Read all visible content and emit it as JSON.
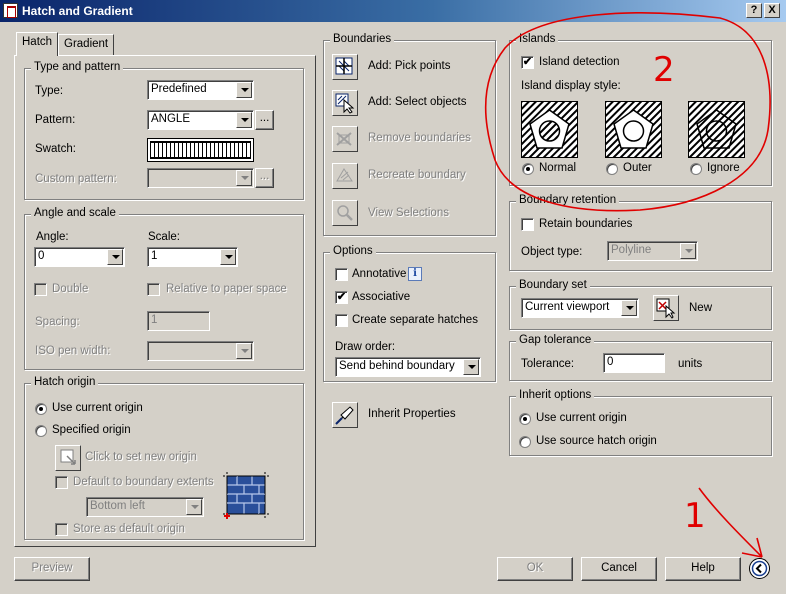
{
  "window": {
    "title": "Hatch and Gradient",
    "help_btn": "?",
    "close_btn": "X"
  },
  "tabs": [
    {
      "label": "Hatch"
    },
    {
      "label": "Gradient"
    }
  ],
  "type_pattern": {
    "legend": "Type and pattern",
    "type_label": "Type:",
    "type_value": "Predefined",
    "pattern_label": "Pattern:",
    "pattern_value": "ANGLE",
    "pattern_browse": "...",
    "swatch_label": "Swatch:",
    "custom_label": "Custom pattern:",
    "custom_value": "",
    "custom_browse": "..."
  },
  "angle_scale": {
    "legend": "Angle and scale",
    "angle_label": "Angle:",
    "angle_value": "0",
    "scale_label": "Scale:",
    "scale_value": "1",
    "double_label": "Double",
    "relative_label": "Relative to paper space",
    "spacing_label": "Spacing:",
    "spacing_value": "1",
    "iso_label": "ISO pen width:",
    "iso_value": ""
  },
  "hatch_origin": {
    "legend": "Hatch origin",
    "use_current": "Use current origin",
    "specified": "Specified origin",
    "click_to_set": "Click to set new origin",
    "default_extents": "Default to boundary extents",
    "extents_value": "Bottom left",
    "store_default": "Store as default origin"
  },
  "boundaries": {
    "legend": "Boundaries",
    "add_pick": "Add: Pick points",
    "add_select": "Add: Select objects",
    "remove": "Remove boundaries",
    "recreate": "Recreate boundary",
    "view": "View Selections"
  },
  "options": {
    "legend": "Options",
    "annotative": "Annotative",
    "associative": "Associative",
    "separate": "Create separate hatches",
    "draw_order_label": "Draw order:",
    "draw_order_value": "Send behind boundary"
  },
  "inherit": {
    "label": "Inherit Properties"
  },
  "islands": {
    "legend": "Islands",
    "detection": "Island detection",
    "style_label": "Island display style:",
    "normal": "Normal",
    "outer": "Outer",
    "ignore": "Ignore",
    "annotation_number": "2"
  },
  "boundary_retention": {
    "legend": "Boundary retention",
    "retain": "Retain boundaries",
    "object_type_label": "Object type:",
    "object_type_value": "Polyline"
  },
  "boundary_set": {
    "legend": "Boundary set",
    "value": "Current viewport",
    "new_label": "New"
  },
  "gap": {
    "legend": "Gap tolerance",
    "tolerance_label": "Tolerance:",
    "value": "0",
    "units": "units"
  },
  "inherit_options": {
    "legend": "Inherit options",
    "use_current": "Use current origin",
    "use_source": "Use source hatch origin"
  },
  "footer": {
    "preview": "Preview",
    "ok": "OK",
    "cancel": "Cancel",
    "help": "Help",
    "annotation_number": "1"
  },
  "colors": {
    "accent_annotation": "#e00000",
    "titlebar": "#0a246a",
    "face": "#d4d0c8"
  },
  "icons": [
    "pick-points-icon",
    "select-objects-icon",
    "remove-boundaries-icon",
    "recreate-boundary-icon",
    "view-selections-icon",
    "inherit-properties-icon",
    "boundary-new-icon",
    "origin-click-icon",
    "origin-preview-icon",
    "info-icon",
    "collapse-chevron-icon"
  ]
}
